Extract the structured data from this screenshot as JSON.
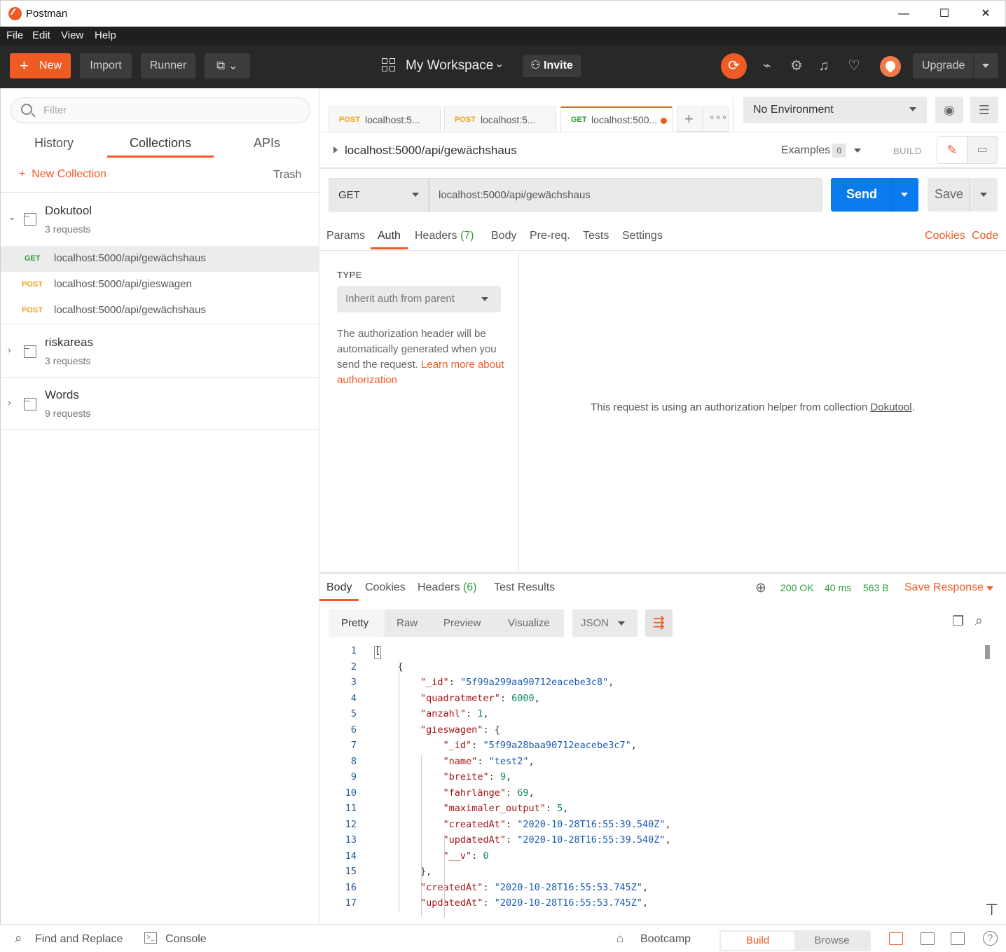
{
  "window": {
    "title": "Postman",
    "minimize": "—",
    "maximize": "☐",
    "close": "✕"
  },
  "menu": [
    "File",
    "Edit",
    "View",
    "Help"
  ],
  "header": {
    "new_label": "New",
    "import_label": "Import",
    "runner_label": "Runner",
    "workspace_label": "My Workspace",
    "invite_label": "Invite",
    "upgrade_label": "Upgrade",
    "accent": "#ef5b25"
  },
  "sidebar": {
    "filter_placeholder": "Filter",
    "tabs": [
      "History",
      "Collections",
      "APIs"
    ],
    "new_collection": "New Collection",
    "trash": "Trash",
    "collections": [
      {
        "name": "Dokutool",
        "count": "3 requests"
      },
      {
        "name": "riskareas",
        "count": "3 requests"
      },
      {
        "name": "Words",
        "count": "9 requests"
      }
    ],
    "requests": [
      {
        "method": "GET",
        "url": "localhost:5000/api/gewächshaus"
      },
      {
        "method": "POST",
        "url": "localhost:5000/api/gieswagen"
      },
      {
        "method": "POST",
        "url": "localhost:5000/api/gewächshaus"
      }
    ]
  },
  "tabs": [
    {
      "method": "POST",
      "label": "localhost:5..."
    },
    {
      "method": "POST",
      "label": "localhost:5..."
    },
    {
      "method": "GET",
      "label": "localhost:500..."
    }
  ],
  "environment": "No Environment",
  "request": {
    "title": "localhost:5000/api/gewächshaus",
    "examples_label": "Examples",
    "examples_count": "0",
    "build_label": "BUILD",
    "method": "GET",
    "url": "localhost:5000/api/gewächshaus",
    "send_label": "Send",
    "save_label": "Save",
    "tabs": [
      "Params",
      "Auth",
      "Headers",
      "Body",
      "Pre-req.",
      "Tests",
      "Settings"
    ],
    "headers_count": "(7)",
    "cookies_link": "Cookies",
    "code_link": "Code"
  },
  "auth": {
    "type_label": "TYPE",
    "type_value": "Inherit auth from parent",
    "desc": "The authorization header will be automatically generated when you send the request.",
    "learn_link": "Learn more about authorization",
    "helper_prefix": "This request is using an authorization helper from collection",
    "helper_collection": "Dokutool",
    "helper_suffix": "."
  },
  "response": {
    "tabs": [
      "Body",
      "Cookies",
      "Headers",
      "Test Results"
    ],
    "headers_count": "(6)",
    "status": "200 OK",
    "time": "40 ms",
    "size": "563 B",
    "save_response": "Save Response",
    "views": [
      "Pretty",
      "Raw",
      "Preview",
      "Visualize"
    ],
    "format": "JSON"
  },
  "code_lines": [
    {
      "n": "1",
      "html": "["
    },
    {
      "n": "2",
      "html": "    {"
    },
    {
      "n": "3",
      "html": "        <span class='k'>\"_id\"</span>: <span class='s'>\"5f99a299aa90712eacebe3c8\"</span>,"
    },
    {
      "n": "4",
      "html": "        <span class='k'>\"quadratmeter\"</span>: <span class='n'>6000</span>,"
    },
    {
      "n": "5",
      "html": "        <span class='k'>\"anzahl\"</span>: <span class='n'>1</span>,"
    },
    {
      "n": "6",
      "html": "        <span class='k'>\"gieswagen\"</span>: {"
    },
    {
      "n": "7",
      "html": "            <span class='k'>\"_id\"</span>: <span class='s'>\"5f99a28baa90712eacebe3c7\"</span>,"
    },
    {
      "n": "8",
      "html": "            <span class='k'>\"name\"</span>: <span class='s'>\"test2\"</span>,"
    },
    {
      "n": "9",
      "html": "            <span class='k'>\"breite\"</span>: <span class='n'>9</span>,"
    },
    {
      "n": "10",
      "html": "            <span class='k'>\"fahrlänge\"</span>: <span class='n'>69</span>,"
    },
    {
      "n": "11",
      "html": "            <span class='k'>\"maximaler_output\"</span>: <span class='n'>5</span>,"
    },
    {
      "n": "12",
      "html": "            <span class='k'>\"createdAt\"</span>: <span class='s'>\"2020-10-28T16:55:39.540Z\"</span>,"
    },
    {
      "n": "13",
      "html": "            <span class='k'>\"updatedAt\"</span>: <span class='s'>\"2020-10-28T16:55:39.540Z\"</span>,"
    },
    {
      "n": "14",
      "html": "            <span class='k'>\"__v\"</span>: <span class='n'>0</span>"
    },
    {
      "n": "15",
      "html": "        },"
    },
    {
      "n": "16",
      "html": "        <span class='k'>\"createdAt\"</span>: <span class='s'>\"2020-10-28T16:55:53.745Z\"</span>,"
    },
    {
      "n": "17",
      "html": "        <span class='k'>\"updatedAt\"</span>: <span class='s'>\"2020-10-28T16:55:53.745Z\"</span>,"
    }
  ],
  "footer": {
    "find_replace": "Find and Replace",
    "console": "Console",
    "bootcamp": "Bootcamp",
    "build": "Build",
    "browse": "Browse"
  }
}
